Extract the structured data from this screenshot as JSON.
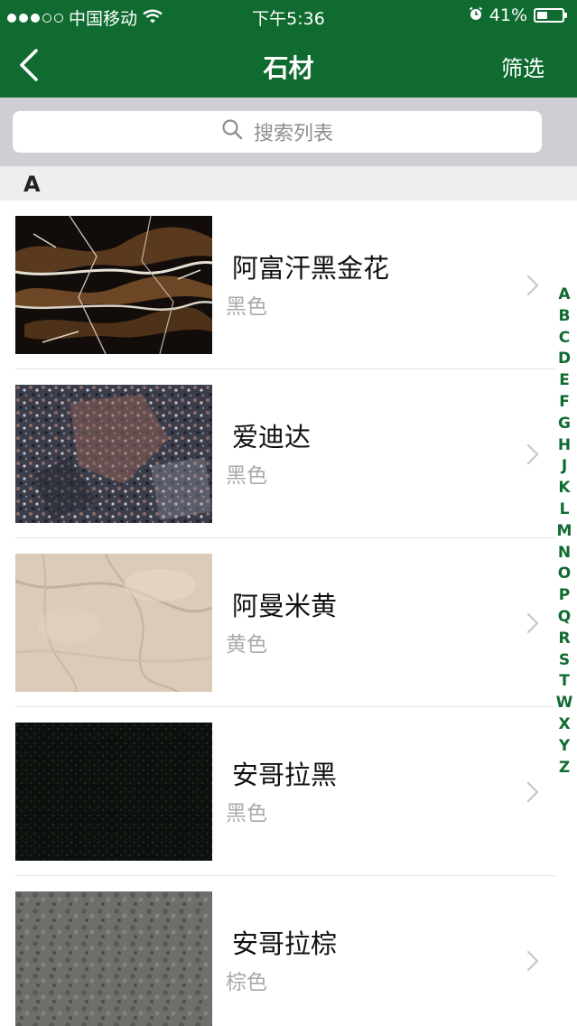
{
  "status_bar": {
    "carrier": "中国移动",
    "time": "下午5:36",
    "battery": "41%",
    "battery_level": 0.41
  },
  "nav": {
    "title": "石材",
    "filter_label": "筛选",
    "back_icon": "chevron-left-icon"
  },
  "search": {
    "placeholder": "搜索列表",
    "icon": "search-icon"
  },
  "section": {
    "letter": "A"
  },
  "items": [
    {
      "name": "阿富汗黑金花",
      "color": "黑色"
    },
    {
      "name": "爱迪达",
      "color": "黑色"
    },
    {
      "name": "阿曼米黄",
      "color": "黄色"
    },
    {
      "name": "安哥拉黑",
      "color": "黑色"
    },
    {
      "name": "安哥拉棕",
      "color": "棕色"
    }
  ],
  "index_letters": [
    "A",
    "B",
    "C",
    "D",
    "E",
    "F",
    "G",
    "H",
    "J",
    "K",
    "L",
    "M",
    "N",
    "O",
    "P",
    "Q",
    "R",
    "S",
    "T",
    "W",
    "X",
    "Y",
    "Z"
  ],
  "colors": {
    "brand_green": "#0f6b30",
    "search_bg": "#cfcfd3",
    "section_bg": "#eeeeee",
    "secondary_text": "#aaaaaa"
  }
}
